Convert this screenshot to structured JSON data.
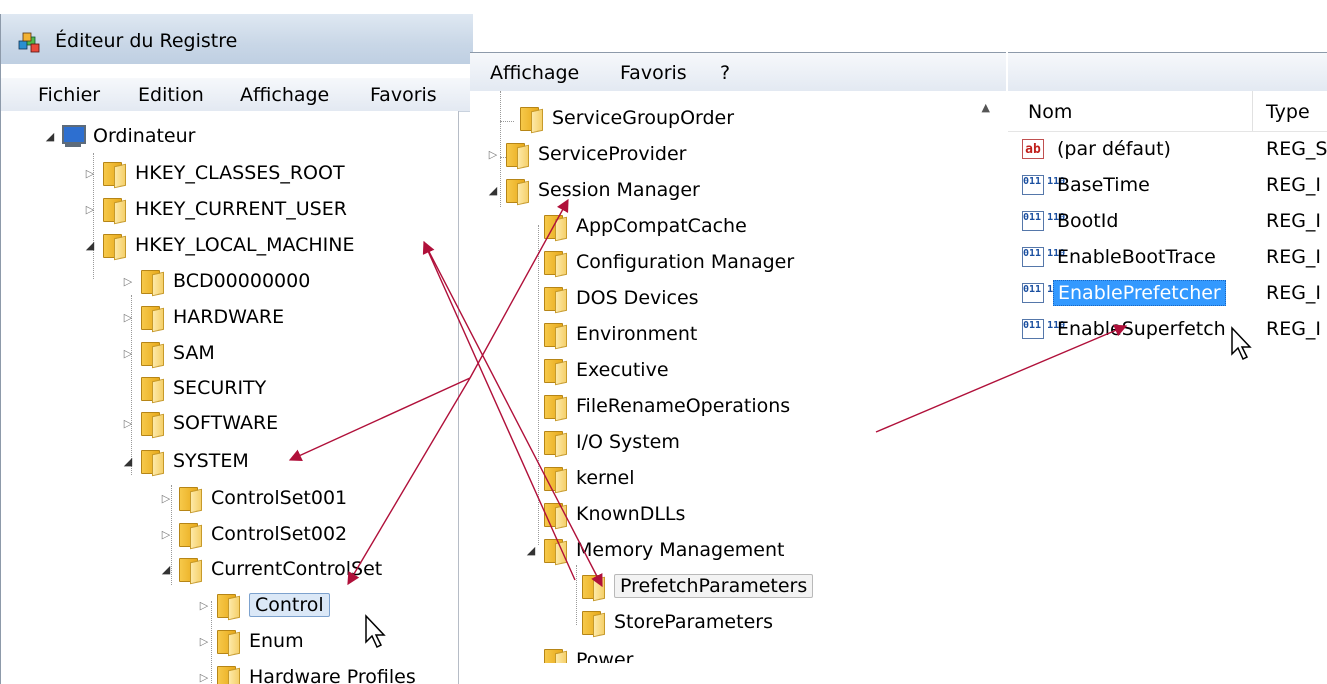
{
  "window": {
    "title": "Éditeur du Registre"
  },
  "menu_left": {
    "file": "Fichier",
    "edit": "Edition",
    "view": "Affichage",
    "favorites": "Favoris"
  },
  "menu_mid": {
    "view": "Affichage",
    "favorites": "Favoris",
    "help": "?"
  },
  "tree_left": {
    "root": "Ordinateur",
    "classes_root": "HKEY_CLASSES_ROOT",
    "current_user": "HKEY_CURRENT_USER",
    "local_machine": "HKEY_LOCAL_MACHINE",
    "bcd": "BCD00000000",
    "hardware": "HARDWARE",
    "sam": "SAM",
    "security": "SECURITY",
    "software": "SOFTWARE",
    "system": "SYSTEM",
    "controlset001": "ControlSet001",
    "controlset002": "ControlSet002",
    "currentcontrolset": "CurrentControlSet",
    "control": "Control",
    "enum": "Enum",
    "hardware_profiles": "Hardware Profiles"
  },
  "tree_mid": {
    "service_group_order": "ServiceGroupOrder",
    "service_provider": "ServiceProvider",
    "session_manager": "Session Manager",
    "appcompatcache": "AppCompatCache",
    "configuration_manager": "Configuration Manager",
    "dos_devices": "DOS Devices",
    "environment": "Environment",
    "executive": "Executive",
    "file_rename_operations": "FileRenameOperations",
    "io_system": "I/O System",
    "kernel": "kernel",
    "known_dlls": "KnownDLLs",
    "memory_management": "Memory Management",
    "prefetch_parameters": "PrefetchParameters",
    "store_parameters": "StoreParameters",
    "power": "Power"
  },
  "values_pane": {
    "col_name": "Nom",
    "col_type": "Type",
    "rows": [
      {
        "name": "(par défaut)",
        "type": "REG_S",
        "icon": "string-value-icon",
        "icon_text": "ab"
      },
      {
        "name": "BaseTime",
        "type": "REG_I",
        "icon": "binary-value-icon",
        "icon_text": "011 110"
      },
      {
        "name": "BootId",
        "type": "REG_I",
        "icon": "binary-value-icon",
        "icon_text": "011 110"
      },
      {
        "name": "EnableBootTrace",
        "type": "REG_I",
        "icon": "binary-value-icon",
        "icon_text": "011 110"
      },
      {
        "name": "EnablePrefetcher",
        "type": "REG_I",
        "icon": "binary-value-icon",
        "icon_text": "011 110",
        "selected": true
      },
      {
        "name": "EnableSuperfetch",
        "type": "REG_I",
        "icon": "binary-value-icon",
        "icon_text": "011 110"
      }
    ]
  },
  "colors": {
    "selection": "#3399ff",
    "annotation_arrow": "#b0103a",
    "tree_box": "#dbe8f7"
  }
}
